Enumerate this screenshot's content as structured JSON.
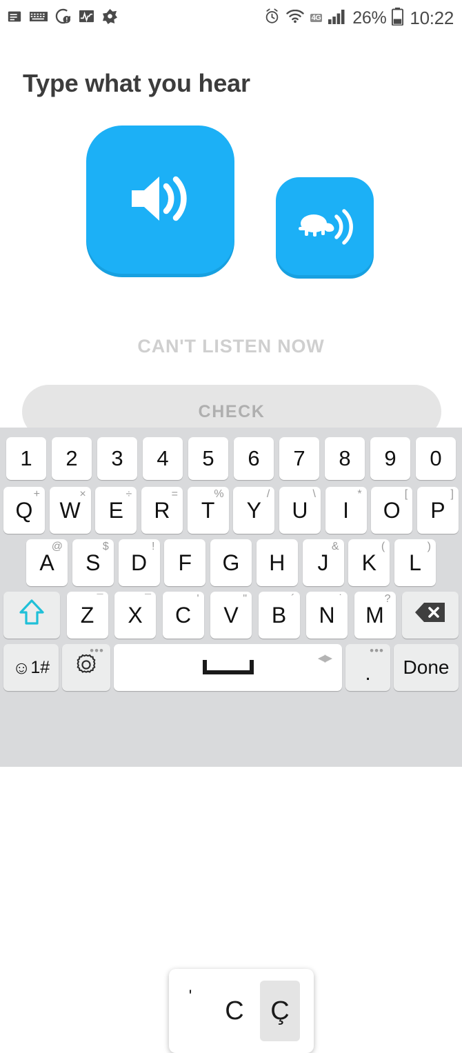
{
  "status_bar": {
    "left_icons": [
      {
        "name": "notes-icon",
        "glyph": "note"
      },
      {
        "name": "keyboard-icon",
        "glyph": "keyboard"
      },
      {
        "name": "do-not-disturb-icon",
        "glyph": "dnd"
      },
      {
        "name": "activity-monitor-icon",
        "glyph": "activity"
      },
      {
        "name": "avast-icon",
        "glyph": "avast"
      }
    ],
    "alarm_icon": "alarm-icon",
    "wifi_icon": "wifi-icon",
    "network_badge": "4G",
    "signal_icon": "signal-bars-icon",
    "battery_percent": "26%",
    "battery_icon": "battery-icon",
    "clock": "10:22"
  },
  "exercise": {
    "title": "Type what you hear",
    "play_button": {
      "name": "play-audio-button",
      "icon": "speaker-icon"
    },
    "play_slow_button": {
      "name": "play-audio-slow-button",
      "icon": "turtle-speaker-icon"
    },
    "cant_listen_label": "CAN'T LISTEN NOW",
    "check_label": "CHECK",
    "accent_color": "#1cb0f6",
    "check_disabled_bg": "#e5e5e5",
    "check_disabled_text": "#afafaf"
  },
  "keyboard": {
    "background": "#d9dadc",
    "rows": {
      "numbers": [
        {
          "main": "1"
        },
        {
          "main": "2"
        },
        {
          "main": "3"
        },
        {
          "main": "4"
        },
        {
          "main": "5"
        },
        {
          "main": "6"
        },
        {
          "main": "7"
        },
        {
          "main": "8"
        },
        {
          "main": "9"
        },
        {
          "main": "0"
        }
      ],
      "qwerty": [
        {
          "main": "Q",
          "sup": "+"
        },
        {
          "main": "W",
          "sup": "×"
        },
        {
          "main": "E",
          "sup": "÷"
        },
        {
          "main": "R",
          "sup": "="
        },
        {
          "main": "T",
          "sup": "%"
        },
        {
          "main": "Y",
          "sup": "/"
        },
        {
          "main": "U",
          "sup": "\\"
        },
        {
          "main": "I",
          "sup": "*"
        },
        {
          "main": "O",
          "sup": "["
        },
        {
          "main": "P",
          "sup": "]"
        }
      ],
      "asdf": [
        {
          "main": "A",
          "sup": "@"
        },
        {
          "main": "S",
          "sup": "$"
        },
        {
          "main": "D",
          "sup": "!"
        },
        {
          "main": "F",
          "sup": ""
        },
        {
          "main": "G",
          "sup": ""
        },
        {
          "main": "H",
          "sup": ""
        },
        {
          "main": "J",
          "sup": "&"
        },
        {
          "main": "K",
          "sup": "("
        },
        {
          "main": "L",
          "sup": ")"
        }
      ],
      "zxcv": [
        {
          "main": "Z",
          "sup": "¯"
        },
        {
          "main": "X",
          "sup": "¯"
        },
        {
          "main": "C",
          "sup": "'"
        },
        {
          "main": "V",
          "sup": "\""
        },
        {
          "main": "B",
          "sup": "´"
        },
        {
          "main": "N",
          "sup": "˙"
        },
        {
          "main": "M",
          "sup": "?"
        }
      ]
    },
    "shift_key": {
      "name": "shift-key",
      "icon": "shift-arrow-icon",
      "color": "#1fc0d8"
    },
    "backspace_key": {
      "name": "backspace-key",
      "icon": "backspace-icon"
    },
    "symbols_key": {
      "name": "symbols-key",
      "label": "1#",
      "icon": "emoji-icon"
    },
    "settings_key": {
      "name": "keyboard-settings-key",
      "icon": "gear-icon",
      "dots": "•••"
    },
    "space_key": {
      "name": "space-key",
      "icon": "space-bar-icon",
      "arrows": "◀▶"
    },
    "period_key": {
      "name": "period-key",
      "label": ".",
      "dots": "•••"
    },
    "done_key": {
      "name": "done-key",
      "label": "Done"
    },
    "popup": {
      "name": "character-variants-popup",
      "items": [
        {
          "label": "'",
          "selected": false
        },
        {
          "label": "C",
          "selected": false
        },
        {
          "label": "Ç",
          "selected": true
        }
      ]
    }
  }
}
